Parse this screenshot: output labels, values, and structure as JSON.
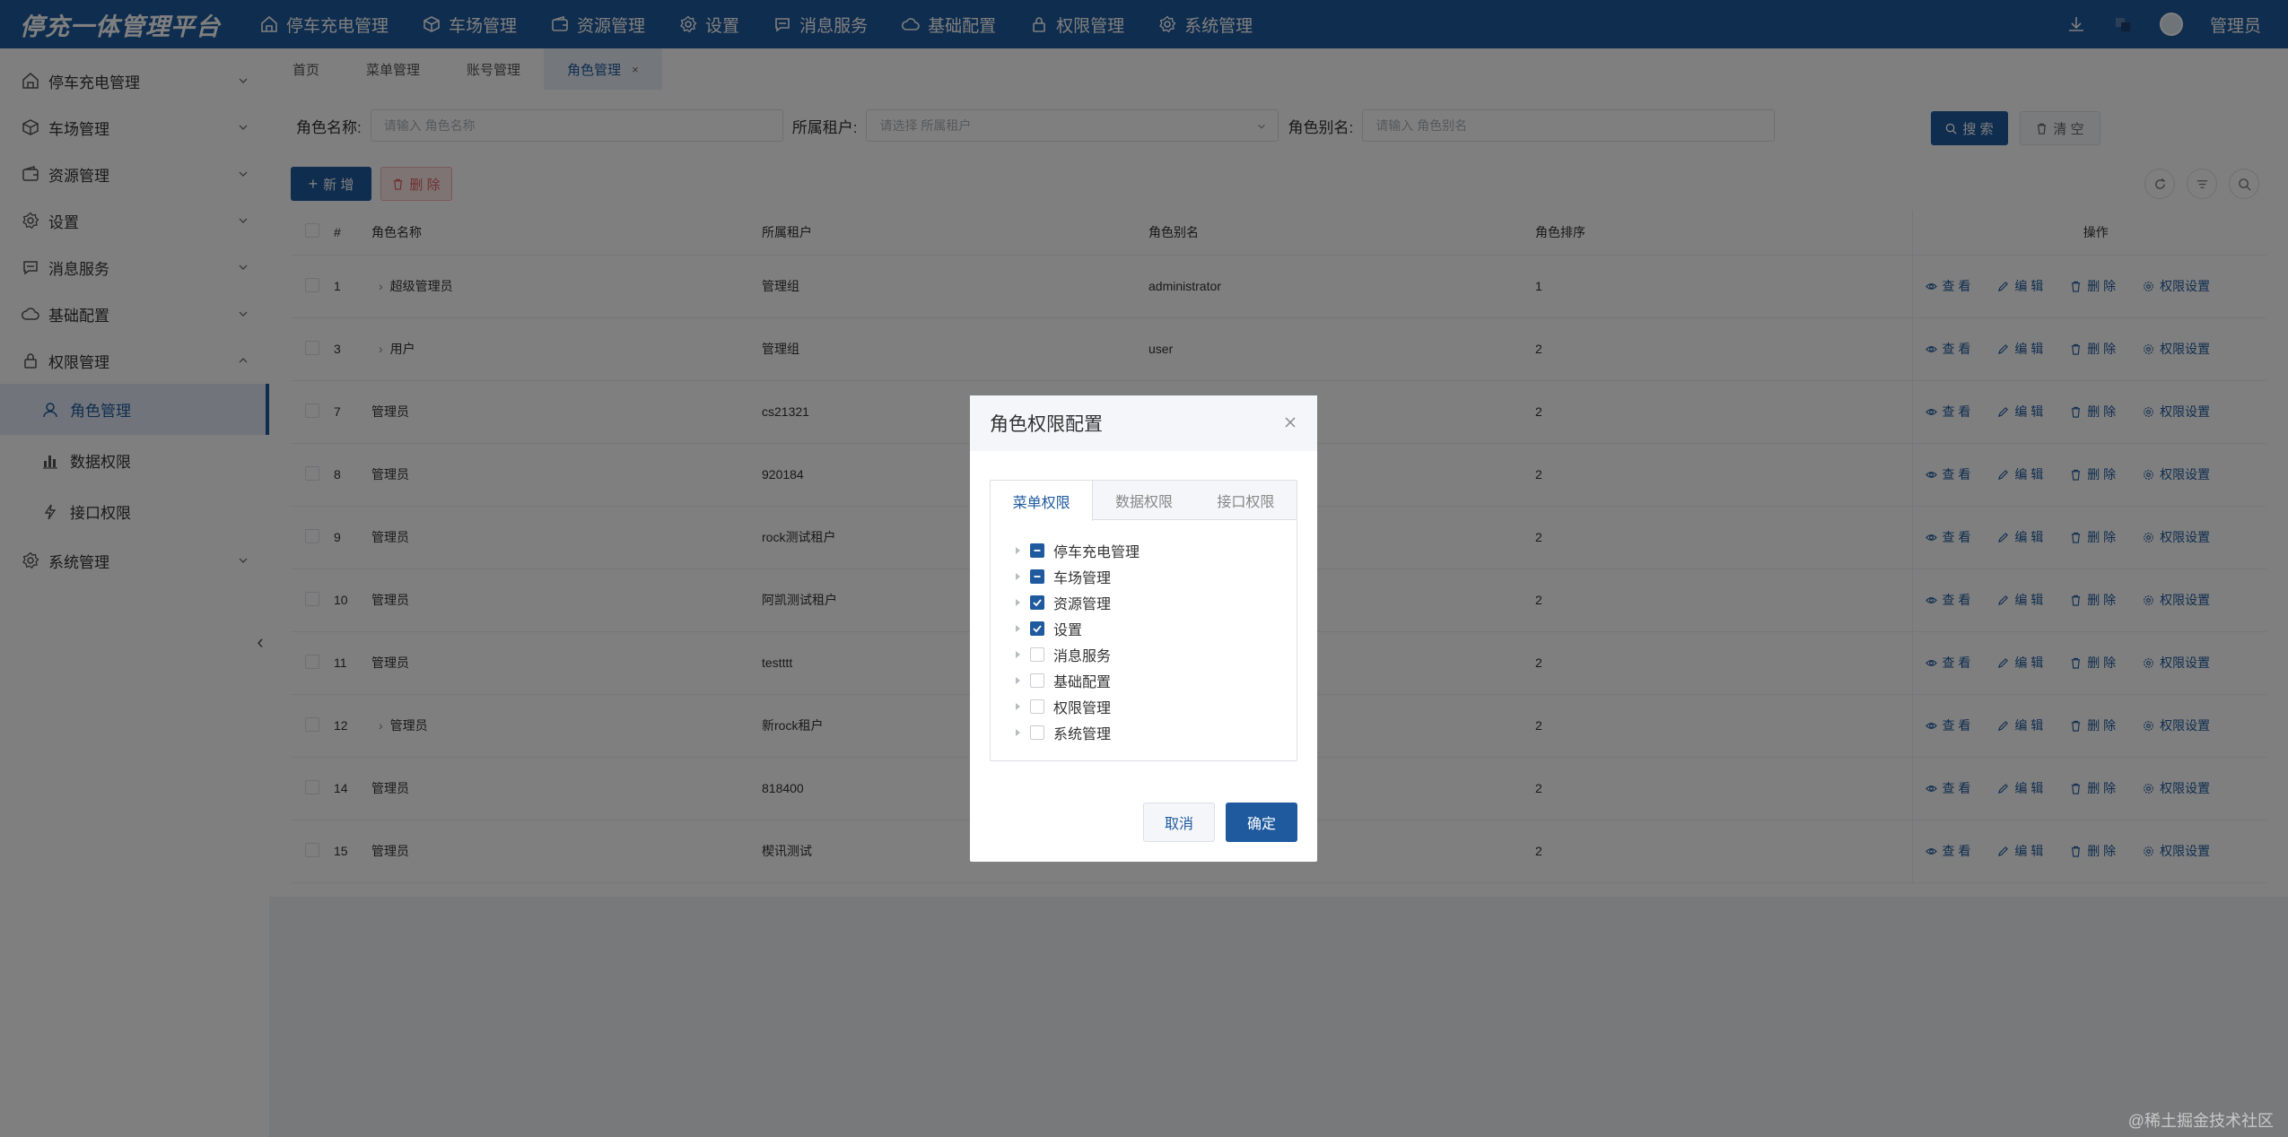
{
  "app": {
    "title": "停充一体管理平台"
  },
  "topnav": [
    {
      "label": "停车充电管理",
      "icon": "home-icon"
    },
    {
      "label": "车场管理",
      "icon": "cube-icon"
    },
    {
      "label": "资源管理",
      "icon": "wallet-icon"
    },
    {
      "label": "设置",
      "icon": "gear-icon"
    },
    {
      "label": "消息服务",
      "icon": "message-icon"
    },
    {
      "label": "基础配置",
      "icon": "cloud-icon"
    },
    {
      "label": "权限管理",
      "icon": "lock-icon"
    },
    {
      "label": "系统管理",
      "icon": "gear-icon"
    }
  ],
  "header": {
    "user": "管理员"
  },
  "sidebar": {
    "items": [
      {
        "label": "停车充电管理"
      },
      {
        "label": "车场管理"
      },
      {
        "label": "资源管理"
      },
      {
        "label": "设置"
      },
      {
        "label": "消息服务"
      },
      {
        "label": "基础配置"
      },
      {
        "label": "权限管理"
      }
    ],
    "subitems": [
      {
        "label": "角色管理"
      },
      {
        "label": "数据权限"
      },
      {
        "label": "接口权限"
      }
    ],
    "last": {
      "label": "系统管理"
    }
  },
  "tabs": [
    {
      "label": "首页"
    },
    {
      "label": "菜单管理"
    },
    {
      "label": "账号管理"
    },
    {
      "label": "角色管理",
      "close": "×"
    }
  ],
  "filter": {
    "role_name_label": "角色名称:",
    "role_name_placeholder": "请输入 角色名称",
    "tenant_label": "所属租户:",
    "tenant_placeholder": "请选择 所属租户",
    "alias_label": "角色别名:",
    "alias_placeholder": "请输入 角色别名",
    "search_btn": "搜 索",
    "clear_btn": "清 空"
  },
  "toolbar": {
    "add_btn": "新 增",
    "delete_btn": "删 除"
  },
  "table": {
    "headers": [
      "#",
      "角色名称",
      "所属租户",
      "角色别名",
      "角色排序",
      "操作"
    ],
    "ops": [
      "查 看",
      "编 辑",
      "删 除",
      "权限设置"
    ],
    "rows": [
      {
        "id": "1",
        "name": "超级管理员",
        "tenant": "管理组",
        "alias": "administrator",
        "sort": "1"
      },
      {
        "id": "3",
        "name": "用户",
        "tenant": "管理组",
        "alias": "user",
        "sort": "2"
      },
      {
        "id": "7",
        "name": "管理员",
        "tenant": "cs21321",
        "alias": "",
        "sort": "2"
      },
      {
        "id": "8",
        "name": "管理员",
        "tenant": "920184",
        "alias": "",
        "sort": "2"
      },
      {
        "id": "9",
        "name": "管理员",
        "tenant": "rock测试租户",
        "alias": "",
        "sort": "2"
      },
      {
        "id": "10",
        "name": "管理员",
        "tenant": "阿凯测试租户",
        "alias": "",
        "sort": "2"
      },
      {
        "id": "11",
        "name": "管理员",
        "tenant": "testttt",
        "alias": "",
        "sort": "2"
      },
      {
        "id": "12",
        "name": "管理员",
        "tenant": "新rock租户",
        "alias": "",
        "sort": "2"
      },
      {
        "id": "14",
        "name": "管理员",
        "tenant": "818400",
        "alias": "",
        "sort": "2"
      },
      {
        "id": "15",
        "name": "管理员",
        "tenant": "楔讯测试",
        "alias": "",
        "sort": "2"
      }
    ]
  },
  "modal": {
    "title": "角色权限配置",
    "tabs": [
      "菜单权限",
      "数据权限",
      "接口权限"
    ],
    "tree": [
      {
        "label": "停车充电管理",
        "state": "partial"
      },
      {
        "label": "车场管理",
        "state": "partial"
      },
      {
        "label": "资源管理",
        "state": "checked"
      },
      {
        "label": "设置",
        "state": "checked"
      },
      {
        "label": "消息服务",
        "state": "unchecked"
      },
      {
        "label": "基础配置",
        "state": "unchecked"
      },
      {
        "label": "权限管理",
        "state": "unchecked"
      },
      {
        "label": "系统管理",
        "state": "unchecked"
      }
    ],
    "cancel": "取消",
    "confirm": "确定"
  },
  "watermark": "@稀土掘金技术社区",
  "colors": {
    "brand": "#1f5a9e",
    "danger": "#e06060"
  }
}
